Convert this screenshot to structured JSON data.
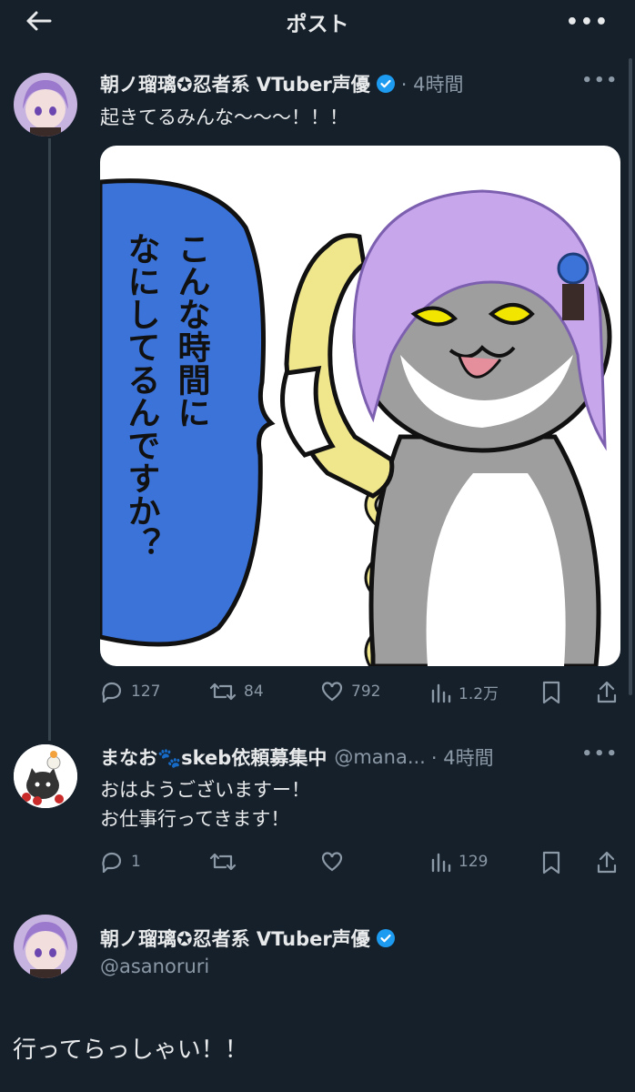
{
  "header": {
    "title": "ポスト",
    "back_icon": "arrow-left-icon",
    "more_icon": "more-horizontal-icon"
  },
  "post1": {
    "name": "朝ノ瑠璃✪忍者系 VTuber声優",
    "time": "· 4時間",
    "text": "起きてるみんな〜〜〜！！！",
    "bubble_text": [
      "こんな時間に",
      "なにしてるんですか？"
    ],
    "actions": {
      "replies": "127",
      "reposts": "84",
      "likes": "792",
      "views": "1.2万"
    }
  },
  "post2": {
    "name": "まなお🐾skeb依頼募集中",
    "handle": "@mana...",
    "time": "· 4時間",
    "text_lines": [
      "おはようございますー！",
      "お仕事行ってきます！"
    ],
    "actions": {
      "replies": "1",
      "reposts": "",
      "likes": "",
      "views": "129"
    }
  },
  "post3": {
    "name": "朝ノ瑠璃✪忍者系 VTuber声優",
    "handle": "@asanoruri",
    "text": "行ってらっしゃい！！"
  },
  "colors": {
    "background": "#15202b",
    "text": "#e7e9ea",
    "secondary": "#8b98a5",
    "verified": "#1d9bf0",
    "bubble": "#3b73d9"
  }
}
